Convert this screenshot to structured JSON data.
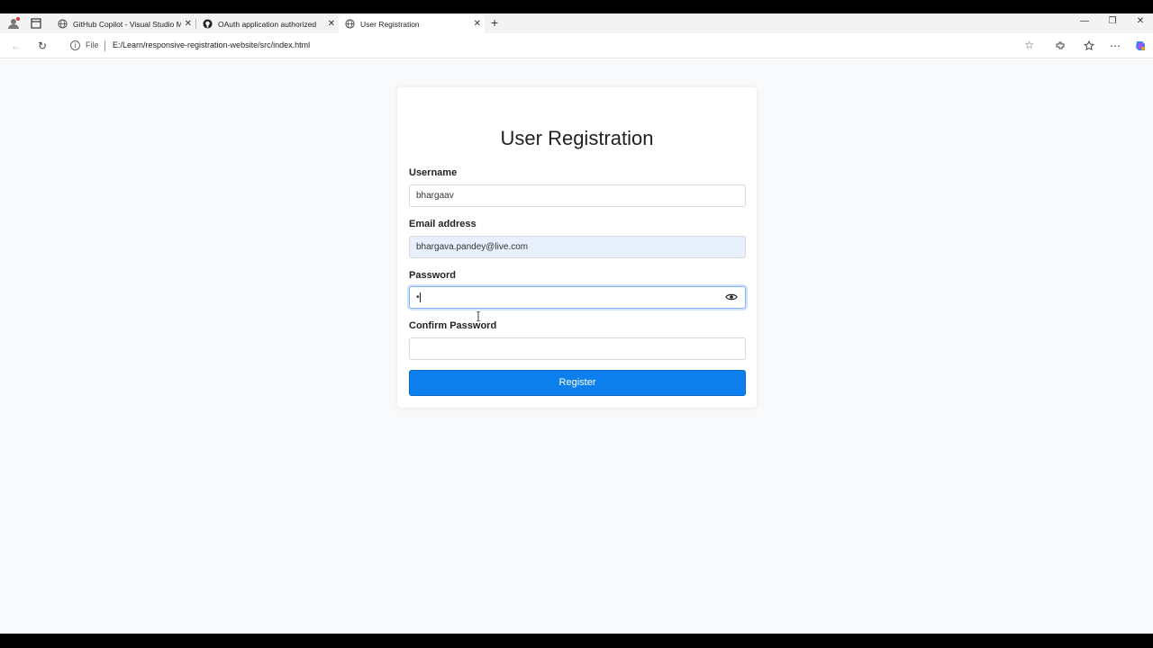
{
  "browser": {
    "tabs": [
      {
        "title": "GitHub Copilot - Visual Studio Mar",
        "icon": "globe-icon"
      },
      {
        "title": "OAuth application authorized",
        "icon": "github-icon"
      },
      {
        "title": "User Registration",
        "icon": "globe-icon"
      }
    ],
    "address": {
      "scheme_label": "File",
      "url": "E:/Learn/responsive-registration-website/src/index.html"
    }
  },
  "form": {
    "title": "User Registration",
    "username_label": "Username",
    "username_value": "bhargaav",
    "email_label": "Email address",
    "email_value": "bhargava.pandey@live.com",
    "password_label": "Password",
    "password_value": "•",
    "confirm_label": "Confirm Password",
    "confirm_value": "",
    "submit_label": "Register"
  },
  "colors": {
    "primary": "#0d7fed",
    "autofill": "#e8f0fe",
    "focus": "#86b7fe"
  }
}
